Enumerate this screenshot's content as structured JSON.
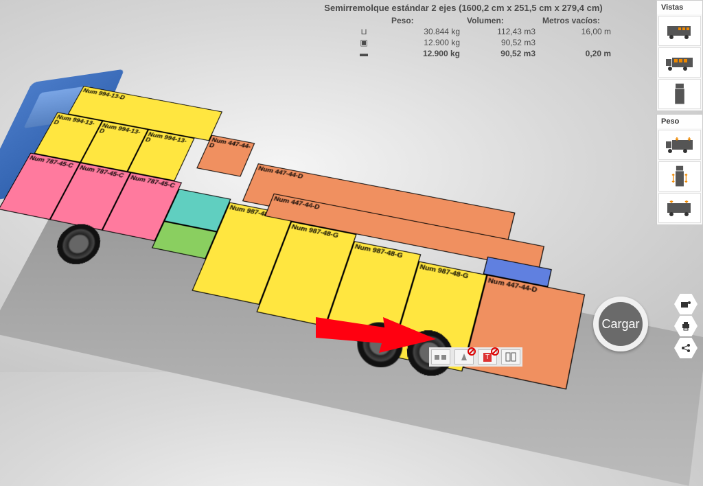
{
  "header": {
    "title": "Semirremolque estándar 2 ejes (1600,2 cm x 251,5 cm x 279,4 cm)",
    "columns": {
      "peso": "Peso:",
      "volumen": "Volumen:",
      "metros": "Metros vacíos:"
    },
    "rows": [
      {
        "icon": "axle-icon",
        "peso": "30.844 kg",
        "volumen": "112,43 m3",
        "metros": "16,00 m",
        "bold": false
      },
      {
        "icon": "container-empty-icon",
        "peso": "12.900 kg",
        "volumen": "90,52 m3",
        "metros": "",
        "bold": false
      },
      {
        "icon": "container-full-icon",
        "peso": "12.900 kg",
        "volumen": "90,52 m3",
        "metros": "0,20 m",
        "bold": true
      }
    ]
  },
  "right_panel": {
    "vistas": {
      "label": "Vistas"
    },
    "peso": {
      "label": "Peso"
    }
  },
  "cargar_button": {
    "label": "Cargar"
  },
  "cargo_labels": {
    "num_994": "Num 994-13-D",
    "num_787": "Num 787-45-C",
    "num_447": "Num 447-44-D",
    "num_987": "Num 987-48-G"
  }
}
